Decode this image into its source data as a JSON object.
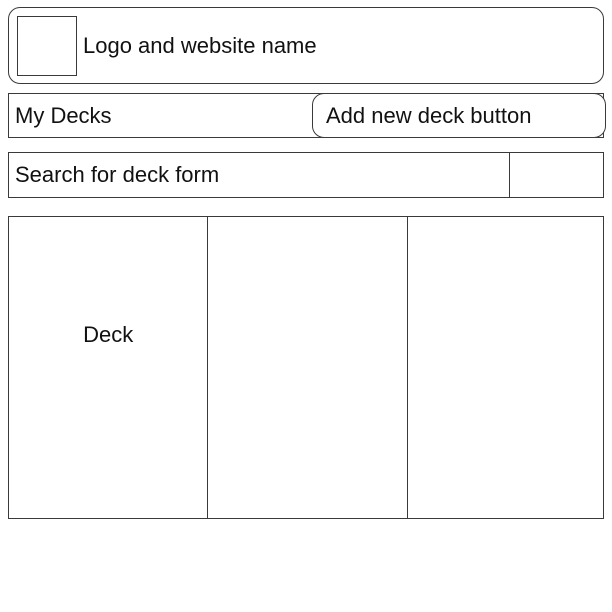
{
  "header": {
    "site_name": "Logo and website name"
  },
  "decks_section": {
    "title": "My Decks",
    "add_button_label": "Add new deck button"
  },
  "search": {
    "placeholder": "Search for deck form"
  },
  "decks": [
    {
      "label": "Deck"
    },
    {
      "label": ""
    },
    {
      "label": ""
    }
  ]
}
